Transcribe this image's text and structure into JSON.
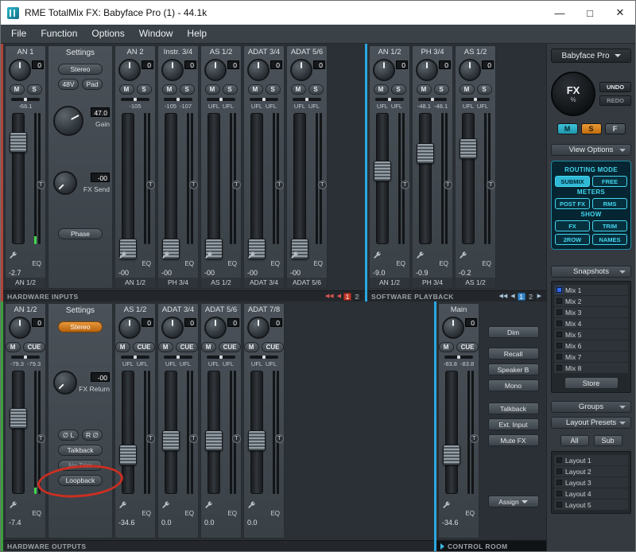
{
  "window": {
    "title": "RME TotalMix FX: Babyface Pro (1) - 44.1k",
    "minimize_icon": "—",
    "maximize_icon": "□",
    "close_icon": "✕"
  },
  "menu": {
    "items": [
      "File",
      "Function",
      "Options",
      "Window",
      "Help"
    ]
  },
  "strip_labels": {
    "trim": "T",
    "eq": "EQ"
  },
  "hardware_inputs": {
    "section_label": "HARDWARE INPUTS",
    "pager": {
      "back_all": "◀◀",
      "back": "◀",
      "pages": [
        "1",
        "2"
      ]
    },
    "settings": {
      "title": "Settings",
      "stereo": "Stereo",
      "p48": "48V",
      "pad": "Pad",
      "gain_value": "47.0",
      "gain_label": "Gain",
      "fx_value": "-00",
      "fx_label": "FX Send",
      "phase": "Phase"
    },
    "channels": [
      {
        "name": "AN 1",
        "knob": "0",
        "btn1": "M",
        "btn2": "S",
        "level": "-66.1",
        "db": "-2.7",
        "out": "AN 1/2",
        "fader": 20,
        "meter_l": 6
      },
      {
        "name": "AN 2",
        "knob": "0",
        "btn1": "M",
        "btn2": "S",
        "level": "-105",
        "db": "-00",
        "out": "AN 1/2",
        "fader": 88
      },
      {
        "name": "Instr. 3/4",
        "knob": "0",
        "btn1": "M",
        "btn2": "S",
        "level": "-105 -107",
        "db": "-00",
        "out": "PH 3/4",
        "fader": 88
      },
      {
        "name": "AS 1/2",
        "knob": "0",
        "btn1": "M",
        "btn2": "S",
        "level": "UFL UFL",
        "db": "-00",
        "out": "AS 1/2",
        "fader": 88
      },
      {
        "name": "ADAT 3/4",
        "knob": "0",
        "btn1": "M",
        "btn2": "S",
        "level": "UFL UFL",
        "db": "-00",
        "out": "ADAT 3/4",
        "fader": 88
      },
      {
        "name": "ADAT 5/6",
        "knob": "0",
        "btn1": "M",
        "btn2": "S",
        "level": "UFL UFL",
        "db": "-00",
        "out": "ADAT 5/6",
        "fader": 88
      }
    ]
  },
  "software_playback": {
    "section_label": "SOFTWARE PLAYBACK",
    "pager": {
      "back_all": "◀◀",
      "back": "◀",
      "pages": [
        "1",
        "2"
      ],
      "fwd": "▶"
    },
    "channels": [
      {
        "name": "AN 1/2",
        "knob": "0",
        "btn1": "M",
        "btn2": "S",
        "level": "UFL UFL",
        "db": "-9.0",
        "out": "AN 1/2",
        "fader": 38
      },
      {
        "name": "PH 3/4",
        "knob": "0",
        "btn1": "M",
        "btn2": "S",
        "level": "-48.1 -48.1",
        "db": "-0.9",
        "out": "PH 3/4",
        "fader": 27
      },
      {
        "name": "AS 1/2",
        "knob": "0",
        "btn1": "M",
        "btn2": "S",
        "level": "UFL UFL",
        "db": "-0.2",
        "out": "AS 1/2",
        "fader": 24
      }
    ]
  },
  "hardware_outputs": {
    "section_label": "HARDWARE OUTPUTS",
    "settings": {
      "title": "Settings",
      "stereo": "Stereo",
      "fx_value": "-00",
      "fx_label": "FX Return",
      "phase_l": "∅ L",
      "phase_r": "R ∅",
      "talkback": "Talkback",
      "no_trim": "No Trim",
      "loopback": "Loopback"
    },
    "channels": [
      {
        "name": "AN 1/2",
        "knob": "0",
        "btn1": "M",
        "btn2": "CUE",
        "level": "-79.3 -79.3",
        "db": "-7.4",
        "fader": 33,
        "meter_l": 5
      },
      {
        "name": "AS 1/2",
        "knob": "0",
        "btn1": "M",
        "btn2": "CUE",
        "level": "UFL UFL",
        "db": "-34.6",
        "fader": 58
      },
      {
        "name": "ADAT 3/4",
        "knob": "0",
        "btn1": "M",
        "btn2": "CUE",
        "level": "UFL UFL",
        "db": "0.0",
        "fader": 48
      },
      {
        "name": "ADAT 5/6",
        "knob": "0",
        "btn1": "M",
        "btn2": "CUE",
        "level": "UFL UFL",
        "db": "0.0",
        "fader": 48
      },
      {
        "name": "ADAT 7/8",
        "knob": "0",
        "btn1": "M",
        "btn2": "CUE",
        "level": "UFL UFL",
        "db": "0.0",
        "fader": 48
      }
    ]
  },
  "control_room": {
    "section_label": "CONTROL ROOM",
    "main_channel": {
      "name": "Main",
      "knob": "0",
      "btn1": "M",
      "btn2": "CUE",
      "level": "-83.8 -83.8",
      "db": "-34.6",
      "fader": 58
    },
    "buttons": [
      "Dim",
      "Recall",
      "Speaker B",
      "Mono",
      "Talkback",
      "Ext. Input",
      "Mute FX"
    ],
    "assign": "Assign"
  },
  "sidebar": {
    "device": "Babyface Pro",
    "fx_label": "FX",
    "fx_percent": "%",
    "undo": "UNDO",
    "redo": "REDO",
    "msf": [
      "M",
      "S",
      "F"
    ],
    "view_options_label": "View Options",
    "routing": {
      "mode_label": "ROUTING MODE",
      "submix": "SUBMIX",
      "free": "FREE",
      "meters_label": "METERS",
      "post_fx": "POST FX",
      "rms": "RMS",
      "show_label": "SHOW",
      "fx": "FX",
      "trim": "TRIM",
      "two_row": "2ROW",
      "names": "NAMES"
    },
    "snapshots_label": "Snapshots",
    "snapshots": [
      "Mix 1",
      "Mix 2",
      "Mix 3",
      "Mix 4",
      "Mix 5",
      "Mix 6",
      "Mix 7",
      "Mix 8"
    ],
    "store_label": "Store",
    "groups_label": "Groups",
    "layout_presets_label": "Layout Presets",
    "all_label": "All",
    "sub_label": "Sub",
    "layouts": [
      "Layout 1",
      "Layout 2",
      "Layout 3",
      "Layout 4",
      "Layout 5"
    ]
  },
  "colors": {
    "accent_cyan": "#3fd2ec",
    "accent_orange": "#e08a2f",
    "annotation_red": "#cc2f22",
    "selected_snapshot_blue": "#2f6bff",
    "inputs_edge_red": "#b04438",
    "playback_edge_blue": "#2aa8e0",
    "outputs_edge_green": "#3aa03a"
  }
}
